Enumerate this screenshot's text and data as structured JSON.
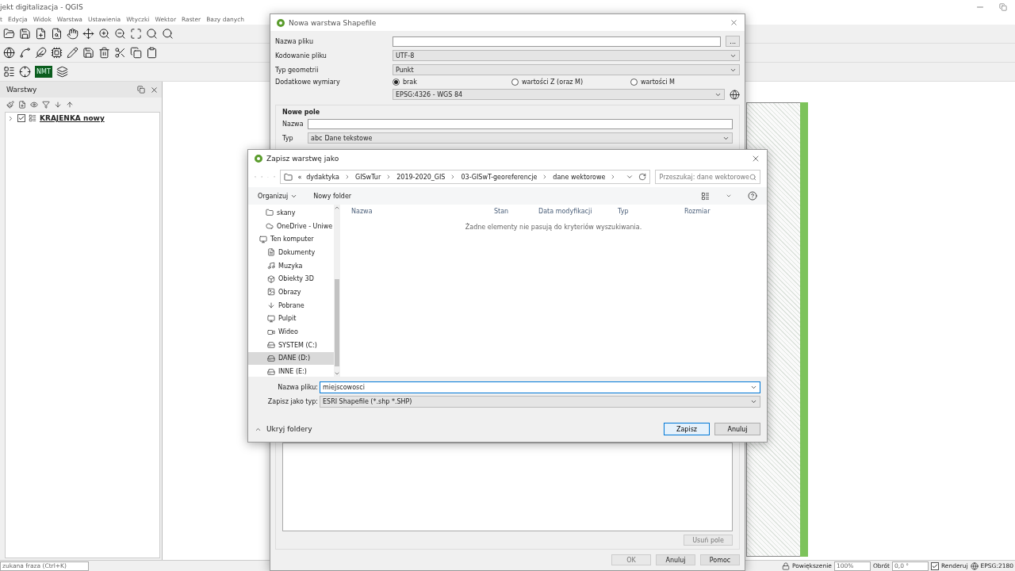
{
  "main_window": {
    "title": "jekt digitalizacja - QGIS",
    "menu": [
      "t",
      "Edycja",
      "Widok",
      "Warstwa",
      "Ustawienia",
      "Wtyczki",
      "Wektor",
      "Raster",
      "Bazy danych"
    ],
    "plugin_badge": "NMT"
  },
  "layers_panel": {
    "title": "Warstwy",
    "layers": [
      {
        "name": "KRAJENKA nowy",
        "checked": true
      }
    ]
  },
  "status_bar": {
    "search_placeholder": "zukana fraza (Ctrl+K)",
    "scale_label": "Powiększenie",
    "scale": "100%",
    "rotation_label": "Obrót",
    "rotation": "0,0 °",
    "render_label": "Renderuj",
    "render": true,
    "crs": "EPSG:2180"
  },
  "new_layer_dialog": {
    "title": "Nowa warstwa Shapefile",
    "file_label": "Nazwa pliku",
    "browse": "...",
    "encoding_label": "Kodowanie pliku",
    "encoding": "UTF-8",
    "geometry_label": "Typ geometrii",
    "geometry": "Punkt",
    "dims_label": "Dodatkowe wymiary",
    "dims": [
      {
        "label": "brak",
        "selected": true
      },
      {
        "label": "wartości Z (oraz M)",
        "selected": false
      },
      {
        "label": "wartości M",
        "selected": false
      }
    ],
    "crs": "EPSG:4326 - WGS 84",
    "group_title": "Nowe pole",
    "name_label": "Nazwa",
    "type_label": "Typ",
    "type_prefix": "abc",
    "type": "Dane tekstowe",
    "remove_button": {
      "label": "Usuń pole",
      "disabled": true
    },
    "buttons": [
      {
        "label": "OK",
        "disabled": true
      },
      {
        "label": "Anuluj",
        "disabled": false
      },
      {
        "label": "Pomoc",
        "disabled": false
      }
    ]
  },
  "save_dialog": {
    "title": "Zapisz warstwę jako",
    "path_prefix": "«",
    "path": [
      "dydaktyka",
      "GISwTur",
      "2019-2020_GIS",
      "03-GISwT-georeferencje",
      "dane wektorowe"
    ],
    "search_placeholder": "Przeszukaj: dane wektorowe",
    "organize": "Organizuj",
    "new_folder": "Nowy folder",
    "nav": [
      {
        "label": "skany",
        "kind": "folder",
        "selected": false
      },
      {
        "label": "OneDrive - Uniwe",
        "kind": "cloud",
        "selected": false
      },
      {
        "label": "Ten komputer",
        "kind": "computer",
        "selected": false,
        "children": [
          {
            "label": "Dokumenty",
            "kind": "document",
            "selected": false
          },
          {
            "label": "Muzyka",
            "kind": "music",
            "selected": false
          },
          {
            "label": "Obiekty 3D",
            "kind": "cube",
            "selected": false
          },
          {
            "label": "Obrazy",
            "kind": "image",
            "selected": false
          },
          {
            "label": "Pobrane",
            "kind": "download",
            "selected": false
          },
          {
            "label": "Pulpit",
            "kind": "desktop",
            "selected": false
          },
          {
            "label": "Wideo",
            "kind": "video",
            "selected": false
          },
          {
            "label": "SYSTEM (C:)",
            "kind": "drive",
            "selected": false
          },
          {
            "label": "DANE (D:)",
            "kind": "drive",
            "selected": true
          },
          {
            "label": "INNE (E:)",
            "kind": "drive",
            "selected": false
          }
        ]
      }
    ],
    "columns": [
      "Nazwa",
      "Stan",
      "Data modyfikacji",
      "Typ",
      "Rozmiar"
    ],
    "empty_message": "Żadne elementy nie pasują do kryteriów wyszukiwania.",
    "filename_label": "Nazwa pliku:",
    "filename": "miejscowosci",
    "filetype_label": "Zapisz jako typ:",
    "filetype": "ESRI Shapefile (*.shp *.SHP)",
    "hide_folders": "Ukryj foldery",
    "buttons": [
      {
        "label": "Zapisz",
        "default": true
      },
      {
        "label": "Anuluj",
        "default": false
      }
    ]
  }
}
